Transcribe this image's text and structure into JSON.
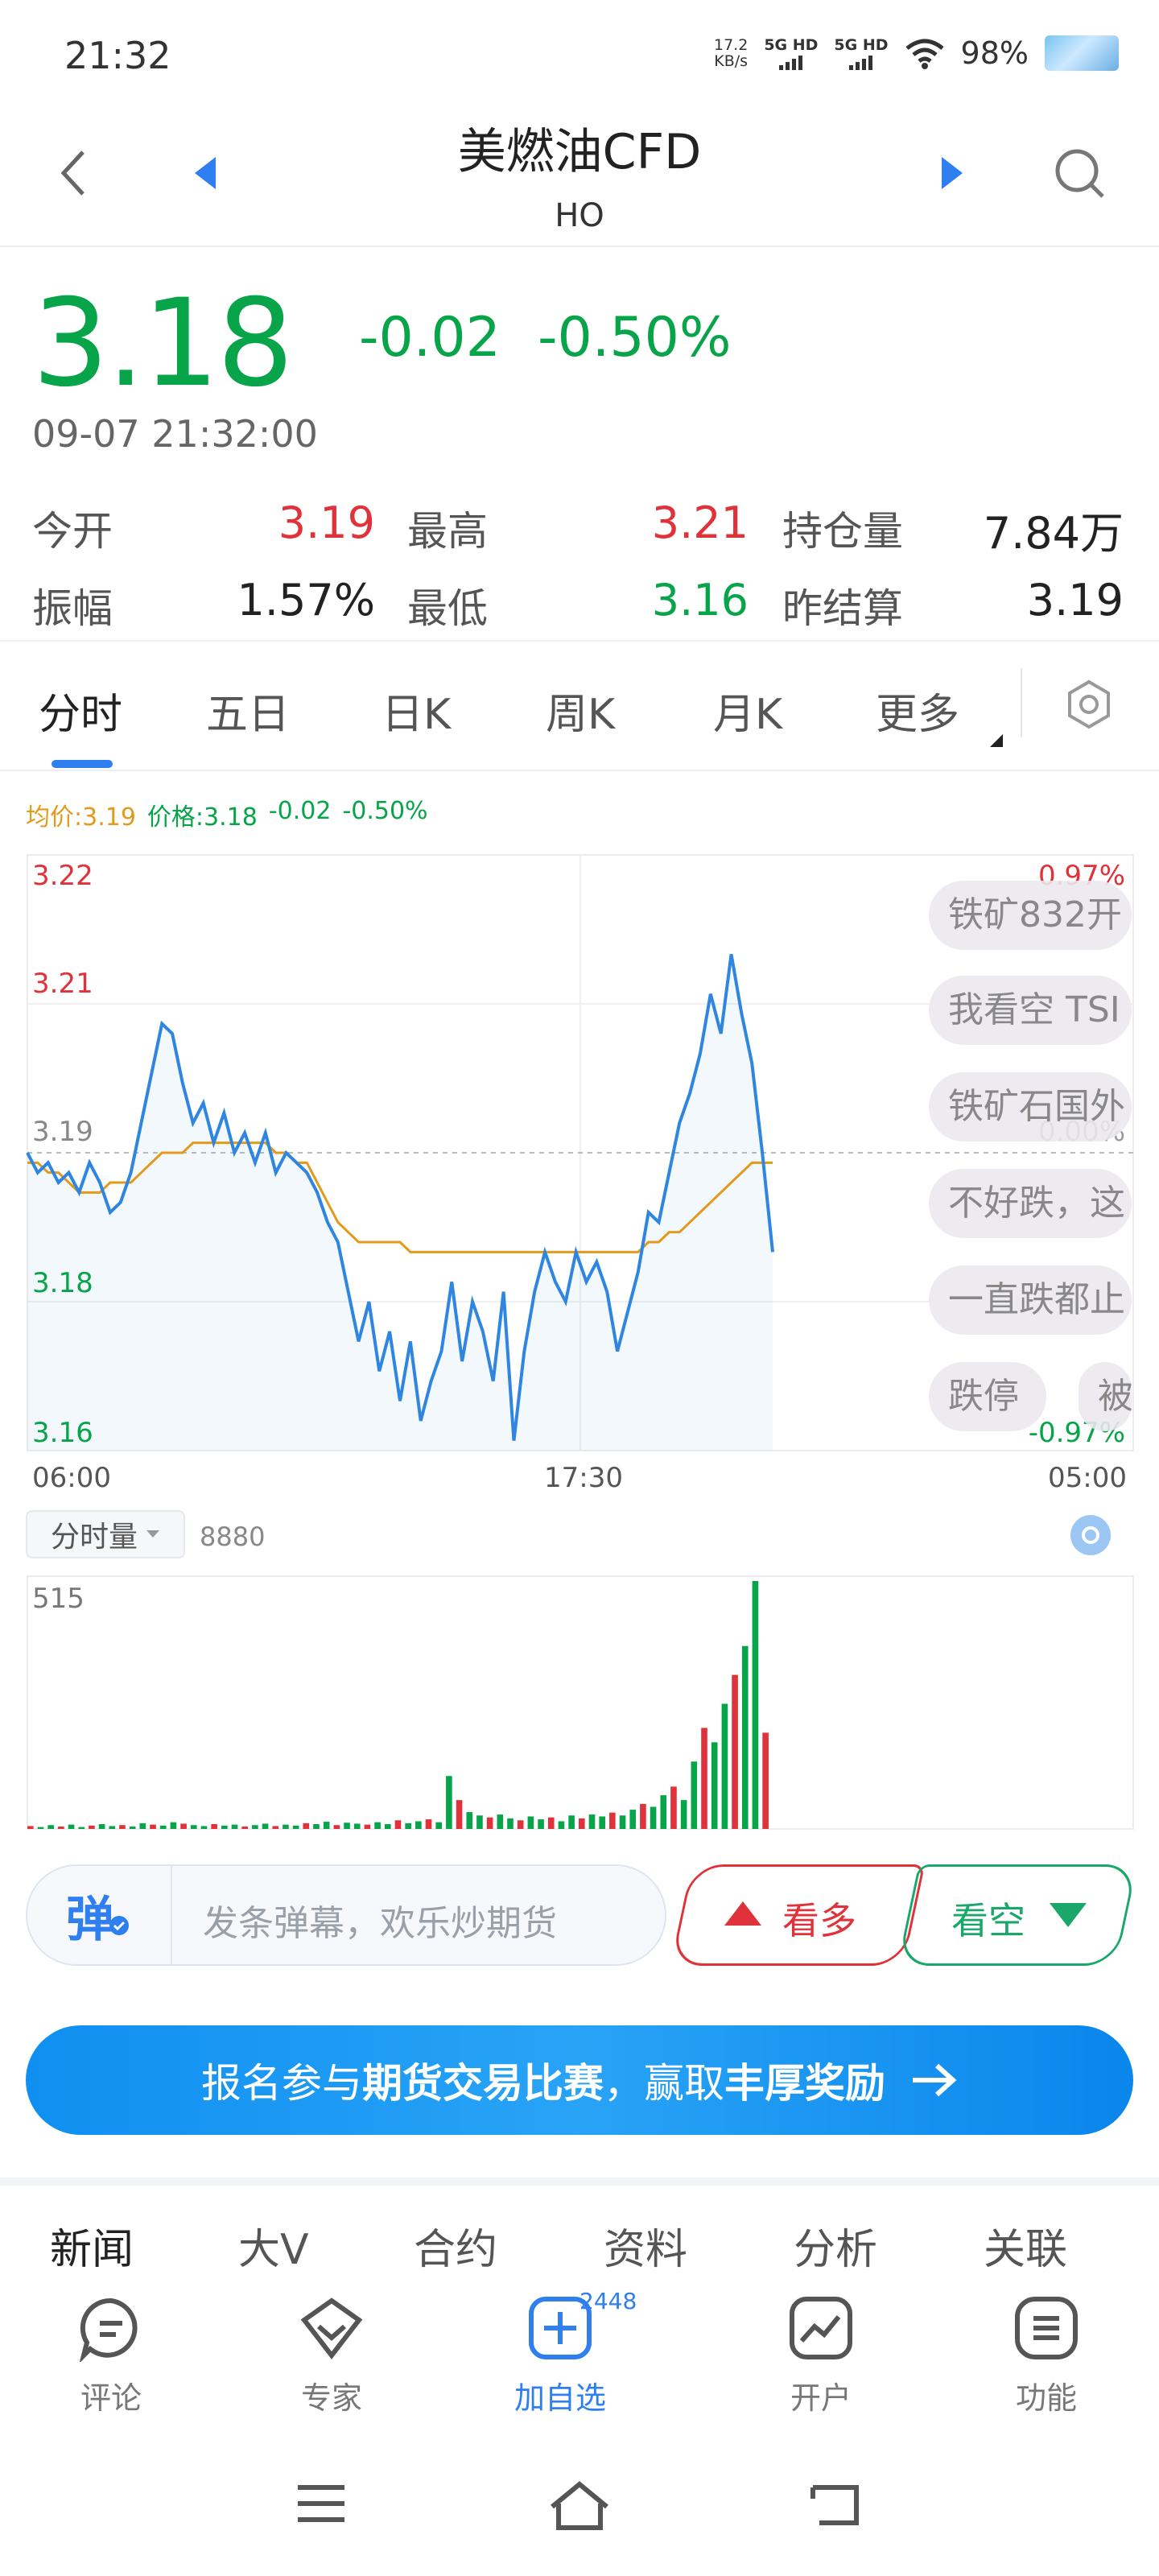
{
  "status_bar": {
    "time": "21:32",
    "net_speed": "17.2",
    "net_unit": "KB/s",
    "sim1": "5G HD",
    "sim2": "5G HD",
    "battery": "98%",
    "icons": [
      "wifi-icon",
      "signal-icon"
    ]
  },
  "header": {
    "title": "美燃油CFD",
    "symbol": "HO",
    "icons": [
      "back-icon",
      "prev-icon",
      "next-icon",
      "search-icon"
    ]
  },
  "quote": {
    "price": "3.18",
    "change": "-0.02",
    "change_pct": "-0.50%",
    "datetime": "09-07 21:32:00",
    "stats": {
      "open_label": "今开",
      "open": "3.19",
      "high_label": "最高",
      "high": "3.21",
      "oi_label": "持仓量",
      "oi": "7.84万",
      "amp_label": "振幅",
      "amp": "1.57%",
      "low_label": "最低",
      "low": "3.16",
      "settle_label": "昨结算",
      "settle": "3.19"
    }
  },
  "tabs": [
    "分时",
    "五日",
    "日K",
    "周K",
    "月K",
    "更多"
  ],
  "chart_legend": {
    "avg": "均价:3.19",
    "price": "价格:3.18",
    "chg": "-0.02",
    "pct": "-0.50%"
  },
  "chart_data": {
    "type": "line",
    "price_axis": [
      "3.22",
      "3.21",
      "3.19",
      "3.18",
      "3.16"
    ],
    "pct_axis": [
      "0.97%",
      "0.00%",
      "-0.97%"
    ],
    "time_axis": [
      "06:00",
      "17:30",
      "05:00"
    ],
    "ylim": [
      3.16,
      3.22
    ],
    "reference": 3.19,
    "series": [
      {
        "values": [
          3.19,
          3.188,
          3.189,
          3.187,
          3.188,
          3.186,
          3.189,
          3.187,
          3.184,
          3.185,
          3.188,
          3.193,
          3.198,
          3.203,
          3.202,
          3.197,
          3.193,
          3.195,
          3.191,
          3.194,
          3.19,
          3.192,
          3.189,
          3.192,
          3.188,
          3.19,
          3.189,
          3.188,
          3.186,
          3.183,
          3.181,
          3.176,
          3.171,
          3.175,
          3.168,
          3.172,
          3.165,
          3.171,
          3.163,
          3.167,
          3.17,
          3.177,
          3.169,
          3.175,
          3.172,
          3.167,
          3.176,
          3.161,
          3.17,
          3.176,
          3.18,
          3.177,
          3.175,
          3.18,
          3.177,
          3.179,
          3.176,
          3.17,
          3.174,
          3.178,
          3.184,
          3.183,
          3.188,
          3.193,
          3.196,
          3.2,
          3.206,
          3.202,
          3.21,
          3.204,
          3.199,
          3.19,
          3.18
        ]
      },
      {
        "values": [
          3.189,
          3.189,
          3.188,
          3.188,
          3.187,
          3.186,
          3.186,
          3.186,
          3.187,
          3.187,
          3.187,
          3.188,
          3.189,
          3.19,
          3.19,
          3.19,
          3.191,
          3.191,
          3.191,
          3.191,
          3.191,
          3.191,
          3.191,
          3.191,
          3.19,
          3.19,
          3.189,
          3.189,
          3.187,
          3.185,
          3.183,
          3.182,
          3.181,
          3.181,
          3.181,
          3.181,
          3.181,
          3.18,
          3.18,
          3.18,
          3.18,
          3.18,
          3.18,
          3.18,
          3.18,
          3.18,
          3.18,
          3.18,
          3.18,
          3.18,
          3.18,
          3.18,
          3.18,
          3.18,
          3.18,
          3.18,
          3.18,
          3.18,
          3.18,
          3.18,
          3.181,
          3.181,
          3.182,
          3.182,
          3.183,
          3.184,
          3.185,
          3.186,
          3.187,
          3.188,
          3.189,
          3.189,
          3.189
        ]
      }
    ]
  },
  "danmaku": [
    "铁矿832开",
    "我看空 TSI",
    "铁矿石国外",
    "不好跌，这",
    "一直跌都止",
    "跌停",
    "被"
  ],
  "volume": {
    "selector": "分时量",
    "value": "8880",
    "max_label": "515"
  },
  "volume_data": {
    "type": "bar",
    "ylim": [
      0,
      515
    ],
    "values": [
      6,
      4,
      8,
      5,
      9,
      4,
      7,
      10,
      6,
      8,
      5,
      12,
      9,
      7,
      14,
      11,
      8,
      6,
      10,
      7,
      9,
      5,
      8,
      11,
      6,
      9,
      7,
      12,
      10,
      15,
      8,
      13,
      11,
      9,
      14,
      10,
      18,
      12,
      16,
      20,
      14,
      110,
      60,
      35,
      28,
      24,
      30,
      22,
      18,
      26,
      20,
      24,
      16,
      28,
      22,
      30,
      26,
      34,
      28,
      40,
      52,
      46,
      70,
      88,
      60,
      140,
      210,
      180,
      260,
      320,
      380,
      515,
      200
    ]
  },
  "input_row": {
    "icon_text": "弹",
    "placeholder": "发条弹幕，欢乐炒期货",
    "long_label": "看多",
    "short_label": "看空"
  },
  "banner": {
    "part1": "报名参与",
    "part2": "期货交易比赛",
    "part3": "，赢取",
    "part4": "丰厚奖励"
  },
  "news_tabs": [
    "新闻",
    "大V",
    "合约",
    "资料",
    "分析",
    "关联"
  ],
  "bottom_nav": {
    "items": [
      "评论",
      "专家",
      "加自选",
      "开户",
      "功能"
    ],
    "badge": "2448"
  },
  "colors": {
    "up": "#e0323a",
    "down": "#07a44a",
    "price_line": "#2f86e0",
    "avg_line": "#e39a1a",
    "accent": "#2f7ff0"
  }
}
